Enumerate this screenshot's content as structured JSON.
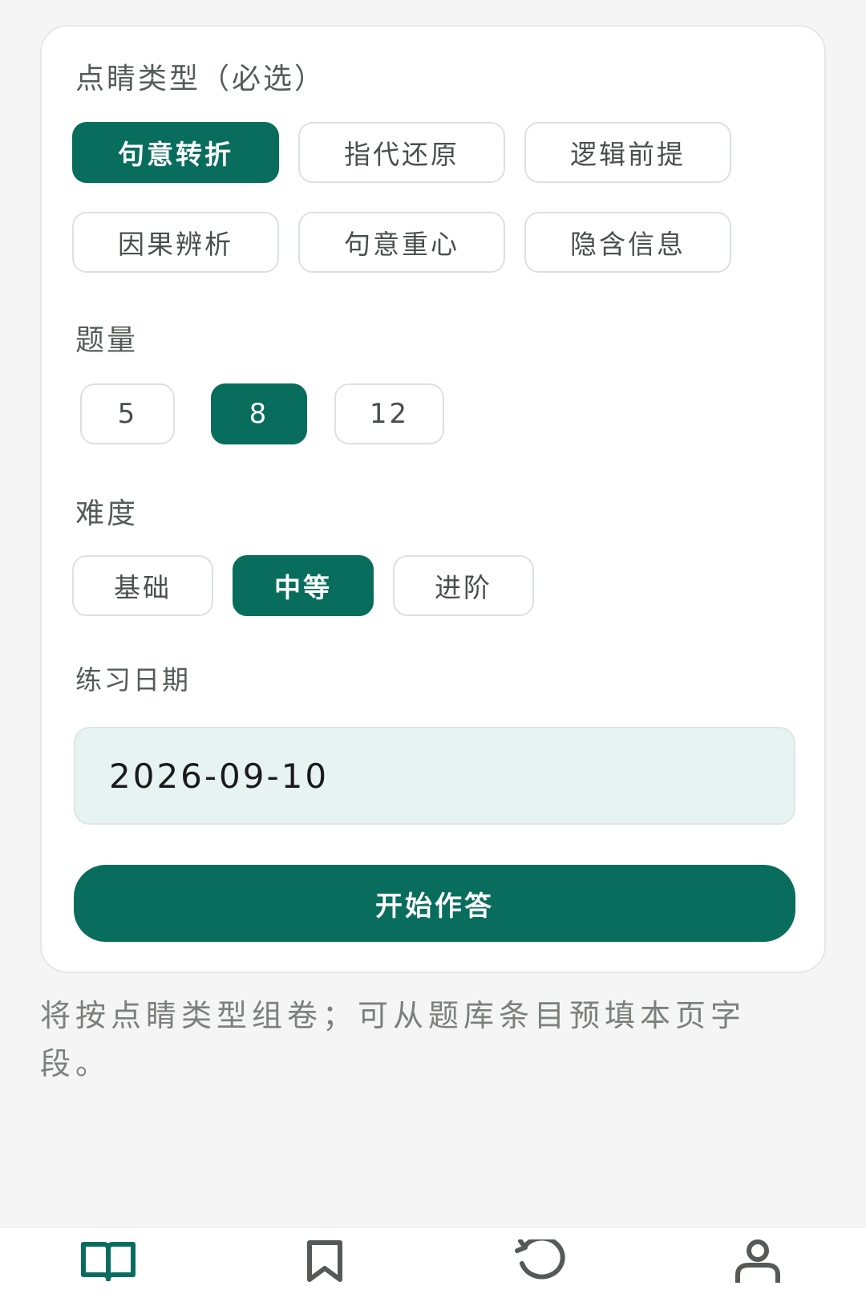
{
  "form": {
    "type_label": "点睛类型（必选）",
    "type_options": [
      "句意转折",
      "指代还原",
      "逻辑前提",
      "因果辨析",
      "句意重心",
      "隐含信息"
    ],
    "type_selected": "句意转折",
    "count_label": "题量",
    "count_options": [
      "5",
      "8",
      "12"
    ],
    "count_selected": "8",
    "difficulty_label": "难度",
    "difficulty_options": [
      "基础",
      "中等",
      "进阶"
    ],
    "difficulty_selected": "中等",
    "date_label": "练习日期",
    "date_value": "2026-09-10",
    "start_button": "开始作答"
  },
  "hint": "将按点睛类型组卷；可从题库条目预填本页字段。",
  "tabbar": {
    "items": [
      {
        "icon": "open-book-icon",
        "active": true
      },
      {
        "icon": "bookmark-icon",
        "active": false
      },
      {
        "icon": "history-icon",
        "active": false
      },
      {
        "icon": "user-icon",
        "active": false
      }
    ]
  },
  "colors": {
    "accent": "#086d5c",
    "field_bg": "#e6f3f0",
    "page_bg": "#f4f5f4"
  }
}
